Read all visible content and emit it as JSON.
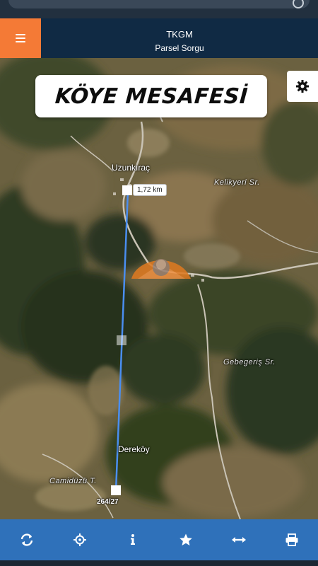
{
  "header": {
    "title": "TKGM",
    "subtitle": "Parsel Sorgu"
  },
  "banner": {
    "text": "KÖYE MESAFESİ"
  },
  "map": {
    "places": {
      "uzunkirac": "Uzunkıraç",
      "kelikyeri": "Kelikyeri Sr.",
      "gebegeris": "Gebegeriş Sr.",
      "derekoy": "Dereköy",
      "camiduzu": "Camidüzü T."
    },
    "measurement": {
      "distance_label": "1,72 km",
      "line_color": "#4a8ef0"
    },
    "parcel_label": "264/27"
  },
  "toolbar": {
    "icons": [
      "refresh-icon",
      "locate-icon",
      "info-icon",
      "star-icon",
      "measure-icon",
      "print-icon"
    ],
    "color": "#2f71ba"
  },
  "colors": {
    "header": "#102a44",
    "menu_button": "#f47a36"
  }
}
